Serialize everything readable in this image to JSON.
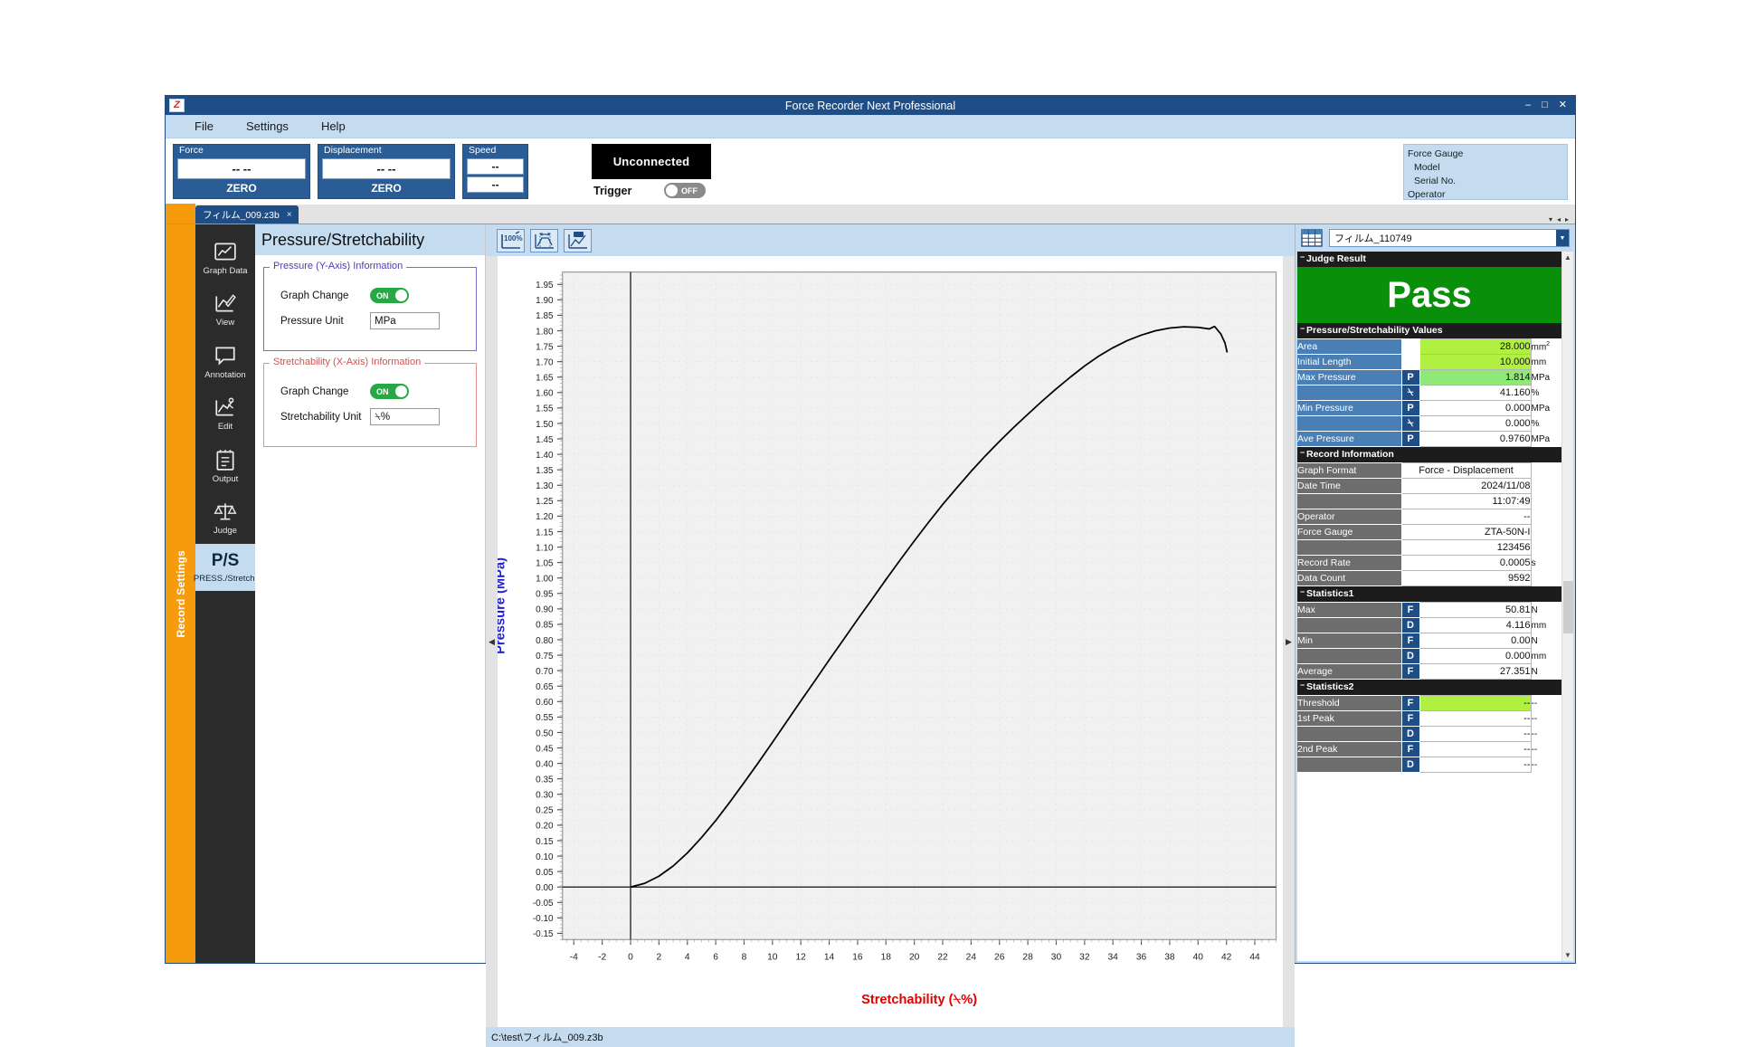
{
  "window": {
    "title": "Force Recorder Next Professional",
    "logo_text": "Z",
    "minimize": "–",
    "maximize": "□",
    "close": "✕"
  },
  "menu": {
    "items": [
      "File",
      "Settings",
      "Help"
    ]
  },
  "readouts": {
    "force": {
      "label": "Force",
      "value": "--  --",
      "zero": "ZERO"
    },
    "displacement": {
      "label": "Displacement",
      "value": "--  --",
      "zero": "ZERO"
    },
    "speed": {
      "label": "Speed",
      "value1": "--",
      "value2": "--"
    },
    "connection": {
      "state": "Unconnected",
      "trigger_label": "Trigger",
      "trigger_state": "OFF"
    },
    "gauge_info": {
      "force_gauge": "Force Gauge",
      "model": "Model",
      "serial_no": "Serial No.",
      "operator": "Operator"
    }
  },
  "tabs": {
    "items": [
      {
        "label": "フィルム_009.z3b",
        "close": "×"
      }
    ],
    "right_controls": [
      "▾",
      "◂",
      "▸"
    ]
  },
  "accent_bar": {
    "label": "Record Settings"
  },
  "nav": {
    "items": [
      {
        "label": "Graph Data",
        "icon": "graph-data-icon",
        "active": false
      },
      {
        "label": "View",
        "icon": "view-pencil-icon",
        "active": false
      },
      {
        "label": "Annotation",
        "icon": "annotation-icon",
        "active": false
      },
      {
        "label": "Edit",
        "icon": "edit-graph-icon",
        "active": false
      },
      {
        "label": "Output",
        "icon": "output-list-icon",
        "active": false
      },
      {
        "label": "Judge",
        "icon": "scales-icon",
        "active": false
      },
      {
        "label": "PRESS./Stretch.",
        "icon": "ps-icon",
        "glyph": "P/S",
        "active": true
      }
    ]
  },
  "settings": {
    "header": "Pressure/Stretchability",
    "pressure_group": {
      "legend": "Pressure (Y-Axis) Information",
      "graph_change_label": "Graph Change",
      "graph_change_state": "ON",
      "unit_label": "Pressure Unit",
      "unit_value": "MPa"
    },
    "stretch_group": {
      "legend": "Stretchability (X-Axis) Information",
      "graph_change_label": "Graph Change",
      "graph_change_state": "ON",
      "unit_label": "Stretchability Unit",
      "unit_value": "⍀%"
    }
  },
  "chart_toolbar": {
    "buttons": [
      {
        "name": "zoom-100-percent-icon",
        "label": "100%"
      },
      {
        "name": "fit-width-icon",
        "label": ""
      },
      {
        "name": "annotate-graph-icon",
        "label": ""
      }
    ]
  },
  "collapse": {
    "left": "◀",
    "right": "▶"
  },
  "statusbar": {
    "path": "C:\\test\\フィルム_009.z3b"
  },
  "chart_data": {
    "type": "line",
    "title": "",
    "xlabel": "Stretchability (⍀%)",
    "ylabel": "Pressure (MPa)",
    "xlabel_color": "#e00000",
    "ylabel_color": "#2222cc",
    "xlim": [
      -4.8,
      45.5
    ],
    "ylim": [
      -0.17,
      1.99
    ],
    "xticks": [
      -4,
      -2,
      0,
      2,
      4,
      6,
      8,
      10,
      12,
      14,
      16,
      18,
      20,
      22,
      24,
      26,
      28,
      30,
      32,
      34,
      36,
      38,
      40,
      42,
      44
    ],
    "yticks": [
      -0.15,
      -0.1,
      -0.05,
      0.0,
      0.05,
      0.1,
      0.15,
      0.2,
      0.25,
      0.3,
      0.35,
      0.4,
      0.45,
      0.5,
      0.55,
      0.6,
      0.65,
      0.7,
      0.75,
      0.8,
      0.85,
      0.9,
      0.95,
      1.0,
      1.05,
      1.1,
      1.15,
      1.2,
      1.25,
      1.3,
      1.35,
      1.4,
      1.45,
      1.5,
      1.55,
      1.6,
      1.65,
      1.7,
      1.75,
      1.8,
      1.85,
      1.9,
      1.95
    ],
    "ytick_step": 0.05,
    "xtick_step": 2,
    "grid": true,
    "legend": "none",
    "series": [
      {
        "name": "Pressure vs Stretchability",
        "color": "#000000",
        "points": [
          [
            0.0,
            0.0
          ],
          [
            1.0,
            0.012
          ],
          [
            2.0,
            0.035
          ],
          [
            3.0,
            0.068
          ],
          [
            4.0,
            0.11
          ],
          [
            5.0,
            0.16
          ],
          [
            6.0,
            0.215
          ],
          [
            7.0,
            0.275
          ],
          [
            8.0,
            0.338
          ],
          [
            9.0,
            0.402
          ],
          [
            10.0,
            0.468
          ],
          [
            11.0,
            0.535
          ],
          [
            12.0,
            0.602
          ],
          [
            13.0,
            0.668
          ],
          [
            14.0,
            0.735
          ],
          [
            15.0,
            0.8
          ],
          [
            16.0,
            0.866
          ],
          [
            17.0,
            0.93
          ],
          [
            18.0,
            0.995
          ],
          [
            19.0,
            1.058
          ],
          [
            20.0,
            1.12
          ],
          [
            21.0,
            1.18
          ],
          [
            22.0,
            1.238
          ],
          [
            23.0,
            1.292
          ],
          [
            24.0,
            1.345
          ],
          [
            25.0,
            1.395
          ],
          [
            26.0,
            1.442
          ],
          [
            27.0,
            1.487
          ],
          [
            28.0,
            1.53
          ],
          [
            29.0,
            1.572
          ],
          [
            30.0,
            1.612
          ],
          [
            31.0,
            1.65
          ],
          [
            32.0,
            1.686
          ],
          [
            33.0,
            1.718
          ],
          [
            34.0,
            1.745
          ],
          [
            35.0,
            1.768
          ],
          [
            36.0,
            1.786
          ],
          [
            37.0,
            1.8
          ],
          [
            38.0,
            1.809
          ],
          [
            39.0,
            1.813
          ],
          [
            40.0,
            1.811
          ],
          [
            40.8,
            1.806
          ],
          [
            41.16,
            1.814
          ],
          [
            41.6,
            1.79
          ],
          [
            41.9,
            1.76
          ],
          [
            42.05,
            1.73
          ]
        ]
      }
    ],
    "axis_lines": {
      "x_zero_vertical": 0,
      "y_zero_horizontal": 0
    }
  },
  "results": {
    "record_selector": "フィルム_110749",
    "table_icon": "table-grid-icon",
    "judge": {
      "header": "Judge Result",
      "value": "Pass",
      "color": "#0a8f0a"
    },
    "pressure_values": {
      "header": "Pressure/Stretchability Values",
      "rows": [
        {
          "label": "Area",
          "sym": "",
          "value": "28.000",
          "unit": "mm²",
          "highlight": "green"
        },
        {
          "label": "Initial Length",
          "sym": "",
          "value": "10.000",
          "unit": "mm",
          "highlight": "green"
        },
        {
          "label": "Max Pressure",
          "sym": "P",
          "value": "1.814",
          "unit": "MPa",
          "highlight": "greenlt"
        },
        {
          "label": "",
          "sym": "⍀",
          "value": "41.160",
          "unit": "%",
          "highlight": ""
        },
        {
          "label": "Min Pressure",
          "sym": "P",
          "value": "0.000",
          "unit": "MPa",
          "highlight": ""
        },
        {
          "label": "",
          "sym": "⍀",
          "value": "0.000",
          "unit": "%",
          "highlight": ""
        },
        {
          "label": "Ave Pressure",
          "sym": "P",
          "value": "0.9760",
          "unit": "MPa",
          "highlight": ""
        }
      ]
    },
    "record_information": {
      "header": "Record Information",
      "rows": [
        {
          "label": "Graph Format",
          "value": "Force - Displacement",
          "unit": "",
          "align": "center"
        },
        {
          "label": "Date Time",
          "value": "2024/11/08",
          "unit": ""
        },
        {
          "label": "",
          "value": "11:07:49",
          "unit": ""
        },
        {
          "label": "Operator",
          "value": "--",
          "unit": ""
        },
        {
          "label": "Force Gauge",
          "value": "ZTA-50N-I",
          "unit": ""
        },
        {
          "label": "",
          "value": "123456",
          "unit": ""
        },
        {
          "label": "Record Rate",
          "value": "0.0005",
          "unit": "s"
        },
        {
          "label": "Data Count",
          "value": "9592",
          "unit": ""
        }
      ]
    },
    "statistics1": {
      "header": "Statistics1",
      "rows": [
        {
          "label": "Max",
          "sym": "F",
          "value": "50.81",
          "unit": "N"
        },
        {
          "label": "",
          "sym": "D",
          "value": "4.116",
          "unit": "mm"
        },
        {
          "label": "Min",
          "sym": "F",
          "value": "0.00",
          "unit": "N"
        },
        {
          "label": "",
          "sym": "D",
          "value": "0.000",
          "unit": "mm"
        },
        {
          "label": "Average",
          "sym": "F",
          "value": "27.351",
          "unit": "N"
        }
      ]
    },
    "statistics2": {
      "header": "Statistics2",
      "rows": [
        {
          "label": "Threshold",
          "sym": "F",
          "value": "--",
          "unit": "--",
          "highlight": "green"
        },
        {
          "label": "1st Peak",
          "sym": "F",
          "value": "--",
          "unit": "--",
          "highlight": ""
        },
        {
          "label": "",
          "sym": "D",
          "value": "--",
          "unit": "--",
          "highlight": ""
        },
        {
          "label": "2nd Peak",
          "sym": "F",
          "value": "--",
          "unit": "--",
          "highlight": ""
        },
        {
          "label": "",
          "sym": "D",
          "value": "--",
          "unit": "--",
          "highlight": ""
        }
      ]
    }
  }
}
